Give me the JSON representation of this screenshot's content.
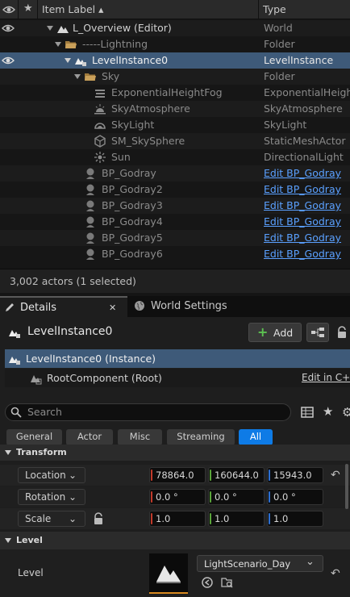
{
  "outliner": {
    "header": {
      "item_label": "Item Label ▴",
      "type": "Type"
    },
    "rows": [
      {
        "label": "L_Overview (Editor)",
        "type": "World"
      },
      {
        "label": "-----Lightning",
        "type": "Folder"
      },
      {
        "label": "LevelInstance0",
        "type": "LevelInstance"
      },
      {
        "label": "Sky",
        "type": "Folder"
      },
      {
        "label": "ExponentialHeightFog",
        "type": "ExponentialHeight"
      },
      {
        "label": "SkyAtmosphere",
        "type": "SkyAtmosphere"
      },
      {
        "label": "SkyLight",
        "type": "SkyLight"
      },
      {
        "label": "SM_SkySphere",
        "type": "StaticMeshActor"
      },
      {
        "label": "Sun",
        "type": "DirectionalLight"
      },
      {
        "label": "BP_Godray",
        "type": "Edit BP_Godray"
      },
      {
        "label": "BP_Godray2",
        "type": "Edit BP_Godray"
      },
      {
        "label": "BP_Godray3",
        "type": "Edit BP_Godray"
      },
      {
        "label": "BP_Godray4",
        "type": "Edit BP_Godray"
      },
      {
        "label": "BP_Godray5",
        "type": "Edit BP_Godray"
      },
      {
        "label": "BP_Godray6",
        "type": "Edit BP_Godray"
      }
    ],
    "status": "3,002 actors (1 selected)"
  },
  "tabs": {
    "details": "Details",
    "close": "✕",
    "world_settings": "World Settings"
  },
  "details": {
    "actor_name": "LevelInstance0",
    "add_label": "Add",
    "components": {
      "instance": "LevelInstance0 (Instance)",
      "root": "RootComponent (Root)",
      "edit_cpp": "Edit in C++"
    },
    "search_placeholder": "Search",
    "filters": [
      "General",
      "Actor",
      "Misc",
      "Streaming",
      "All"
    ],
    "transform": {
      "section": "Transform",
      "location": {
        "label": "Location",
        "x": "78864.0",
        "y": "160644.0",
        "z": "15943.0"
      },
      "rotation": {
        "label": "Rotation",
        "x": "0.0 °",
        "y": "0.0 °",
        "z": "0.0 °"
      },
      "scale": {
        "label": "Scale",
        "x": "1.0",
        "y": "1.0",
        "z": "1.0"
      }
    },
    "level": {
      "section": "Level",
      "label": "Level",
      "value": "LightScenario_Day"
    }
  },
  "colors": {
    "selection": "#3e5a79",
    "link": "#5aa0ff",
    "all_filter": "#0e7be6",
    "add_plus": "#5cc251",
    "x_axis": "#c23a2a",
    "y_axis": "#5aa63a",
    "z_axis": "#2d6fd1"
  }
}
